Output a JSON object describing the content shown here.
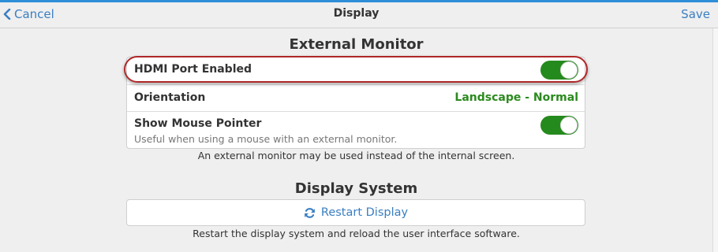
{
  "navbar": {
    "cancel_label": "Cancel",
    "title": "Display",
    "save_label": "Save"
  },
  "external_monitor": {
    "title": "External Monitor",
    "hdmi": {
      "label": "HDMI Port Enabled",
      "enabled": true
    },
    "orientation": {
      "label": "Orientation",
      "value": "Landscape - Normal"
    },
    "mouse_pointer": {
      "label": "Show Mouse Pointer",
      "sublabel": "Useful when using a mouse with an external monitor.",
      "enabled": true
    },
    "caption": "An external monitor may be used instead of the internal screen."
  },
  "display_system": {
    "title": "Display System",
    "restart_label": "Restart Display",
    "caption": "Restart the display system and reload the user interface software."
  },
  "colors": {
    "accent": "#3a7fc1",
    "toggle_on": "#258a1d",
    "value_green": "#2b8a1e",
    "highlight_ring": "#b02828",
    "top_bar": "#2e8fd8"
  },
  "icons": {
    "back": "chevron-left-icon",
    "restart": "refresh-icon"
  }
}
